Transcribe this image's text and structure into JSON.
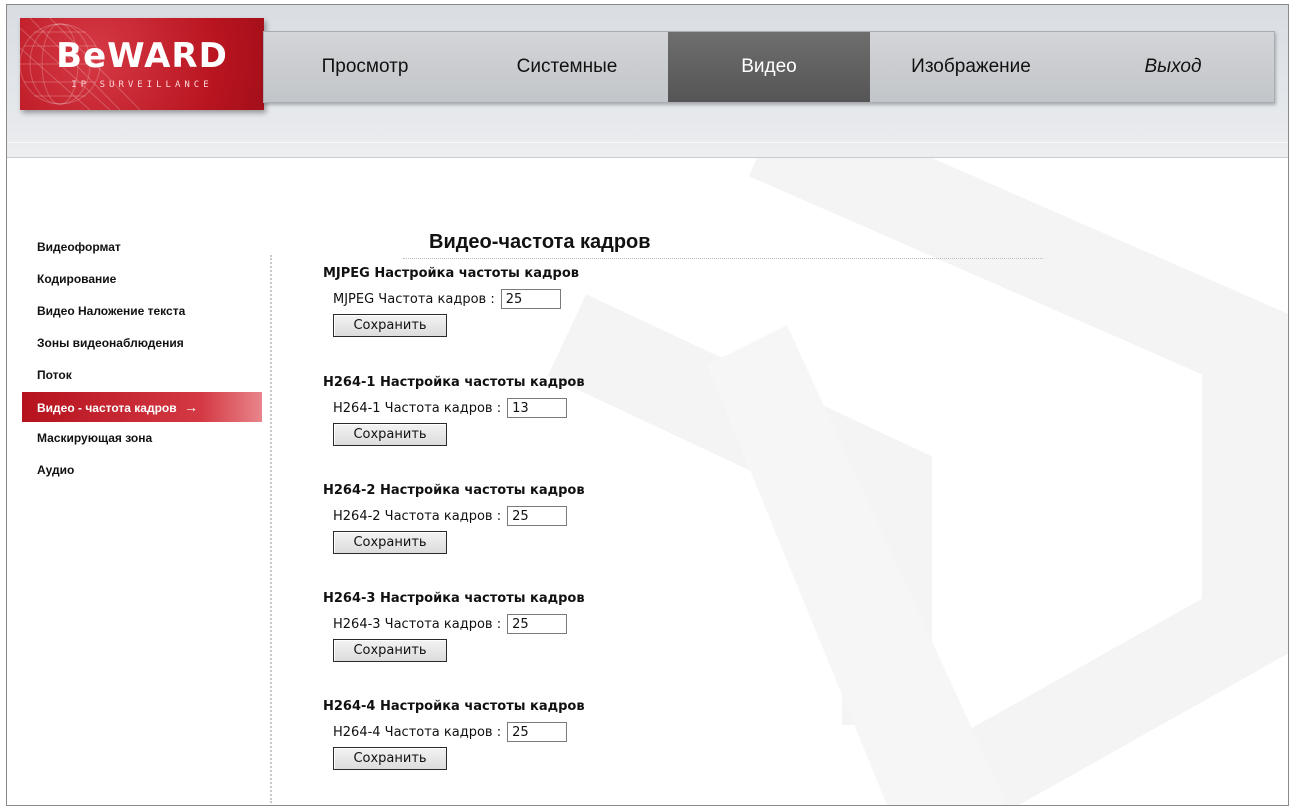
{
  "brand": {
    "logo_text": "BeWARD",
    "logo_sub": "IP SURVEILLANCE",
    "colors": {
      "accent": "#b8141f",
      "nav_active": "#5f5f5f"
    }
  },
  "nav": {
    "items": [
      {
        "label": "Просмотр"
      },
      {
        "label": "Системные"
      },
      {
        "label": "Видео"
      },
      {
        "label": "Изображение"
      },
      {
        "label": "Выход"
      }
    ],
    "active": "Видео"
  },
  "sidebar": {
    "items": [
      {
        "label": "Видеоформат"
      },
      {
        "label": "Кодирование"
      },
      {
        "label": "Видео Наложение текста"
      },
      {
        "label": "Зоны видеонаблюдения"
      },
      {
        "label": "Поток"
      },
      {
        "label": "Видео - частота кадров",
        "arrow": "→"
      },
      {
        "label": "Маскирующая зона"
      },
      {
        "label": "Аудио"
      }
    ],
    "active_index": 5
  },
  "main": {
    "title": "Видео-частота кадров",
    "sections": [
      {
        "title": "MJPEG Настройка частоты кадров",
        "field_label": "MJPEG Частота кадров :",
        "value": "25",
        "button": "Сохранить"
      },
      {
        "title": "H264-1 Настройка частоты кадров",
        "field_label": "H264-1 Частота кадров :",
        "value": "13",
        "button": "Сохранить"
      },
      {
        "title": "H264-2 Настройка частоты кадров",
        "field_label": "H264-2 Частота кадров :",
        "value": "25",
        "button": "Сохранить"
      },
      {
        "title": "H264-3 Настройка частоты кадров",
        "field_label": "H264-3 Частота кадров :",
        "value": "25",
        "button": "Сохранить"
      },
      {
        "title": "H264-4 Настройка частоты кадров",
        "field_label": "H264-4 Частота кадров :",
        "value": "25",
        "button": "Сохранить"
      }
    ]
  }
}
